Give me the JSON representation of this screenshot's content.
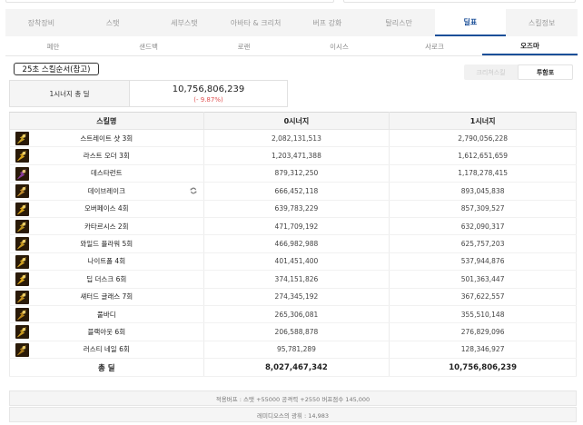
{
  "top_tabs": [
    {
      "label": "장착장비",
      "active": false
    },
    {
      "label": "스탯",
      "active": false
    },
    {
      "label": "세부스탯",
      "active": false
    },
    {
      "label": "아바타 & 크리처",
      "active": false
    },
    {
      "label": "버프 강화",
      "active": false
    },
    {
      "label": "탈리스만",
      "active": false
    },
    {
      "label": "딜표",
      "active": true
    },
    {
      "label": "스킬정보",
      "active": false
    }
  ],
  "sub_tabs": [
    {
      "label": "페만",
      "active": false
    },
    {
      "label": "샌드백",
      "active": false
    },
    {
      "label": "로랜",
      "active": false
    },
    {
      "label": "이시스",
      "active": false
    },
    {
      "label": "사로크",
      "active": false
    },
    {
      "label": "오즈마",
      "active": true
    }
  ],
  "section_title": "25초 스킬순서(참고)",
  "view_toggle": {
    "options": [
      "크리쳐스킬",
      "투함포"
    ],
    "selected": "투함포"
  },
  "synergy_total": {
    "label": "1시너지 총 딜",
    "value": "10,756,806,239",
    "delta": "(- 9.87%)"
  },
  "table": {
    "headers": [
      "스킬명",
      "0시너지",
      "1시너지"
    ],
    "rows": [
      {
        "icon": "streight-shot-icon",
        "name": "스트레이트 샷 3회",
        "v0": "2,082,131,513",
        "v1": "2,790,056,228",
        "color": "#c9a227"
      },
      {
        "icon": "last-order-icon",
        "name": "라스트 오더 3회",
        "v0": "1,203,471,388",
        "v1": "1,612,651,659",
        "color": "#d6a31c"
      },
      {
        "icon": "desperado-icon",
        "name": "데스타런트",
        "v0": "879,312,250",
        "v1": "1,178,278,415",
        "color": "#8a3c9a"
      },
      {
        "icon": "daybreak-icon",
        "name": "데이브레이크",
        "v0": "666,452,118",
        "v1": "893,045,838",
        "color": "#c08a2c",
        "refresh": true
      },
      {
        "icon": "overpace-icon",
        "name": "오버페이스 4회",
        "v0": "639,783,229",
        "v1": "857,309,527",
        "color": "#d4a017"
      },
      {
        "icon": "catharsis-icon",
        "name": "카타르시스 2회",
        "v0": "471,709,192",
        "v1": "632,090,317",
        "color": "#b8901e"
      },
      {
        "icon": "wild-flower-icon",
        "name": "와일드 플라워 5회",
        "v0": "466,982,988",
        "v1": "625,757,203",
        "color": "#c79a22"
      },
      {
        "icon": "nightfall-icon",
        "name": "나이트폴 4회",
        "v0": "401,451,400",
        "v1": "537,944,876",
        "color": "#cfa020"
      },
      {
        "icon": "deep-dusk-icon",
        "name": "딥 더스크 6회",
        "v0": "374,151,826",
        "v1": "501,363,447",
        "color": "#d9a419"
      },
      {
        "icon": "shattered-glass-icon",
        "name": "섀터드 글래스 7회",
        "v0": "274,345,192",
        "v1": "367,622,557",
        "color": "#c28f1f"
      },
      {
        "icon": "full-body-icon",
        "name": "풀바디",
        "v0": "265,306,081",
        "v1": "355,510,148",
        "color": "#b8861d"
      },
      {
        "icon": "blackout-icon",
        "name": "블랙아웃 6회",
        "v0": "206,588,878",
        "v1": "276,829,096",
        "color": "#c99a1e"
      },
      {
        "icon": "rusty-nail-icon",
        "name": "러스티 네일 6회",
        "v0": "95,781,289",
        "v1": "128,346,927",
        "color": "#a87a1a"
      }
    ],
    "total": {
      "label": "총 딜",
      "v0": "8,027,467,342",
      "v1": "10,756,806,239"
    }
  },
  "footer": {
    "buff": "적용버프 : 스탯 +55000 공격력 +2550 버프점수 145,000",
    "light": "레미디오스의 광휘 : 14,983"
  }
}
